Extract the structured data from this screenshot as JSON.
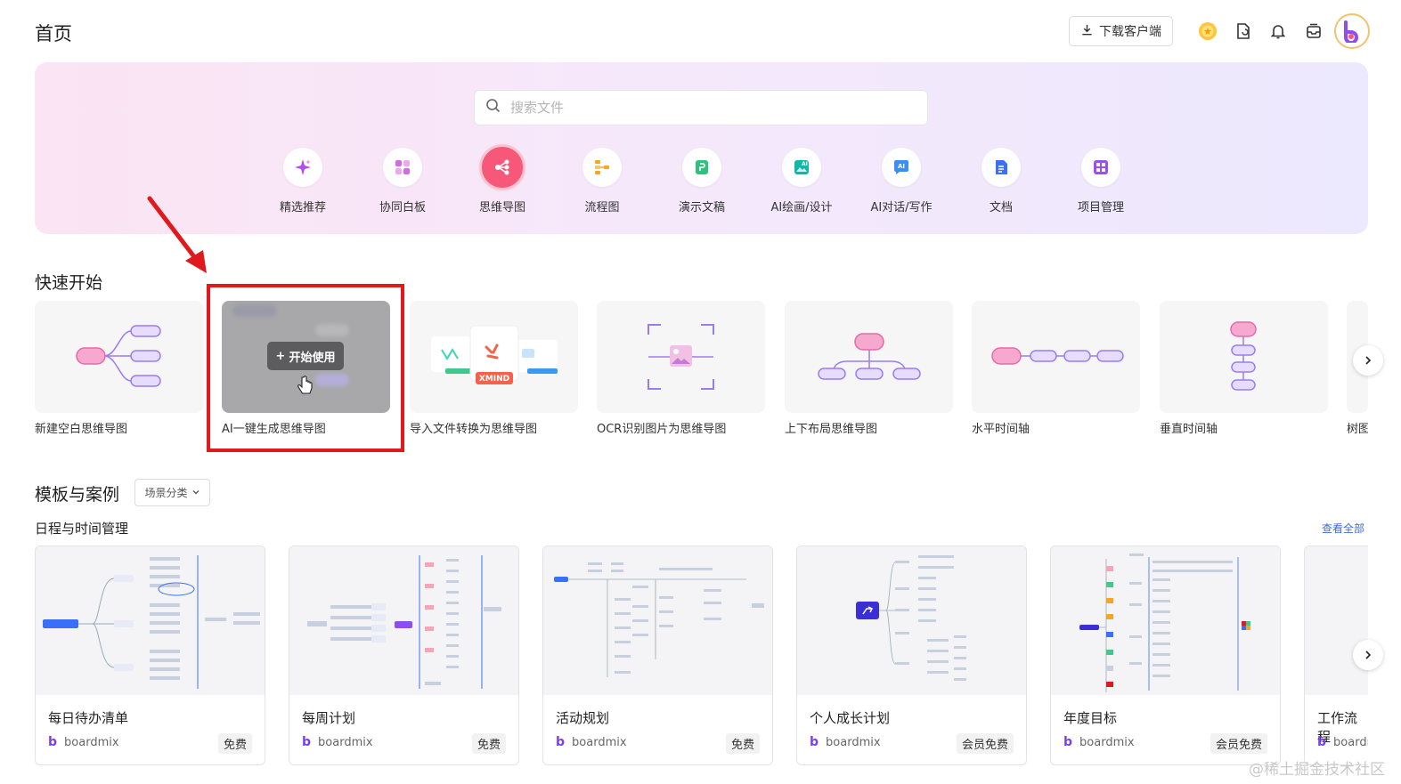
{
  "header": {
    "title": "首页",
    "download_label": "下载客户端",
    "icons": [
      "coin-icon",
      "file-sync-icon",
      "bell-icon",
      "inbox-icon"
    ],
    "avatar_letter": "b"
  },
  "banner": {
    "search_placeholder": "搜索文件",
    "categories": [
      {
        "label": "精选推荐",
        "icon": "sparkle-icon",
        "color": "#b14cf0"
      },
      {
        "label": "协同白板",
        "icon": "whiteboard-icon",
        "color": "#d36be8"
      },
      {
        "label": "思维导图",
        "icon": "mindmap-icon",
        "color": "#f7587a",
        "active": true
      },
      {
        "label": "流程图",
        "icon": "flowchart-icon",
        "color": "#f5a623"
      },
      {
        "label": "演示文稿",
        "icon": "presentation-icon",
        "color": "#2bc47d"
      },
      {
        "label": "AI绘画/设计",
        "icon": "ai-paint-icon",
        "color": "#12b8a6"
      },
      {
        "label": "AI对话/写作",
        "icon": "ai-chat-icon",
        "color": "#3a8ef6"
      },
      {
        "label": "文档",
        "icon": "document-icon",
        "color": "#3a6ff7"
      },
      {
        "label": "项目管理",
        "icon": "kanban-icon",
        "color": "#9b4ff2"
      }
    ]
  },
  "quick_start": {
    "title": "快速开始",
    "start_label": "开始使用",
    "xmind_badge": "XMIND",
    "cards": [
      {
        "label": "新建空白思维导图"
      },
      {
        "label": "AI一键生成思维导图"
      },
      {
        "label": "导入文件转换为思维导图"
      },
      {
        "label": "OCR识别图片为思维导图"
      },
      {
        "label": "上下布局思维导图"
      },
      {
        "label": "水平时间轴"
      },
      {
        "label": "垂直时间轴"
      },
      {
        "label": "树图"
      }
    ]
  },
  "templates": {
    "title": "模板与案例",
    "filter_label": "场景分类",
    "subsection": "日程与时间管理",
    "view_all": "查看全部",
    "items": [
      {
        "name": "每日待办清单",
        "author": "boardmix",
        "price": "免费"
      },
      {
        "name": "每周计划",
        "author": "boardmix",
        "price": "免费"
      },
      {
        "name": "活动规划",
        "author": "boardmix",
        "price": "免费"
      },
      {
        "name": "个人成长计划",
        "author": "boardmix",
        "price": "会员免费"
      },
      {
        "name": "年度目标",
        "author": "boardmix",
        "price": "会员免费"
      },
      {
        "name": "工作流程",
        "author": "boardmix",
        "price": ""
      }
    ]
  },
  "watermark": "@稀土掘金技术社区",
  "colors": {
    "accent": "#f7587a",
    "highlight": "#e0191d",
    "link": "#3f6ad8",
    "node_pink": "#f7a8cf",
    "node_purple": "#9b7cf0"
  }
}
